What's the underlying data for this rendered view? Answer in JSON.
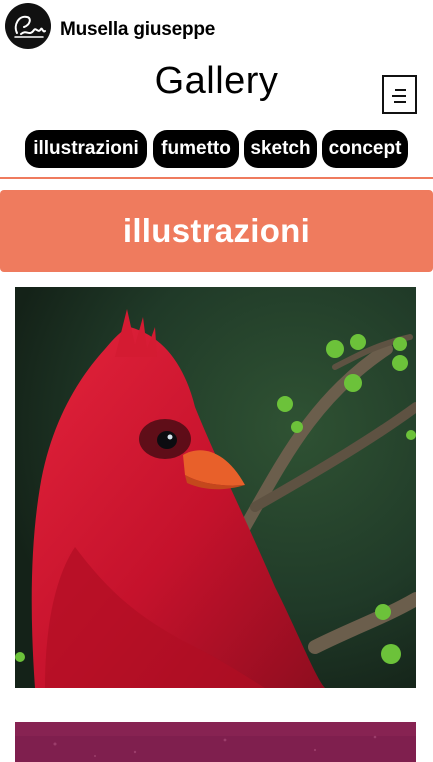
{
  "header": {
    "site_name": "Musella giuseppe",
    "logo_icon": "signature-logo-icon"
  },
  "page": {
    "title": "Gallery",
    "menu_icon": "hamburger-menu-icon"
  },
  "categories": [
    {
      "label": "illustrazioni"
    },
    {
      "label": "fumetto"
    },
    {
      "label": "sketch"
    },
    {
      "label": "concept"
    }
  ],
  "section": {
    "title": "illustrazioni"
  },
  "gallery": {
    "items": [
      {
        "subject": "red cardinal bird painting"
      },
      {
        "subject": "magenta artwork (partially visible)"
      }
    ]
  },
  "colors": {
    "accent": "#ef7b5e",
    "pill_bg": "#000000",
    "pill_text": "#ffffff",
    "cardinal_red": "#c8102e",
    "beak_orange": "#e8602a",
    "background_green": "#1d2e22"
  }
}
